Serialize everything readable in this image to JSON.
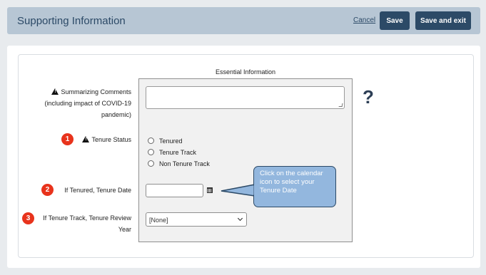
{
  "header": {
    "title": "Supporting Information",
    "cancel_label": "Cancel",
    "save_label": "Save",
    "save_exit_label": "Save and exit"
  },
  "form": {
    "section_title": "Essential Information",
    "comments_label": "Summarizing Comments (including impact of COVID-19 pandemic)",
    "comments_value": "",
    "help_symbol": "?",
    "tenure_status_label": "Tenure Status",
    "tenure_options": [
      "Tenured",
      "Tenure Track",
      "Non Tenure Track"
    ],
    "tenure_date_label": "If Tenured, Tenure Date",
    "tenure_date_value": "",
    "review_year_label": "If Tenure Track, Tenure Review Year",
    "review_year_value": "[None]"
  },
  "annotations": {
    "step1": "1",
    "step2": "2",
    "step3": "3",
    "callout": "Click on the calendar icon to select your Tenure Date",
    "accent_color": "#e8331c",
    "callout_color": "#93b7de"
  }
}
